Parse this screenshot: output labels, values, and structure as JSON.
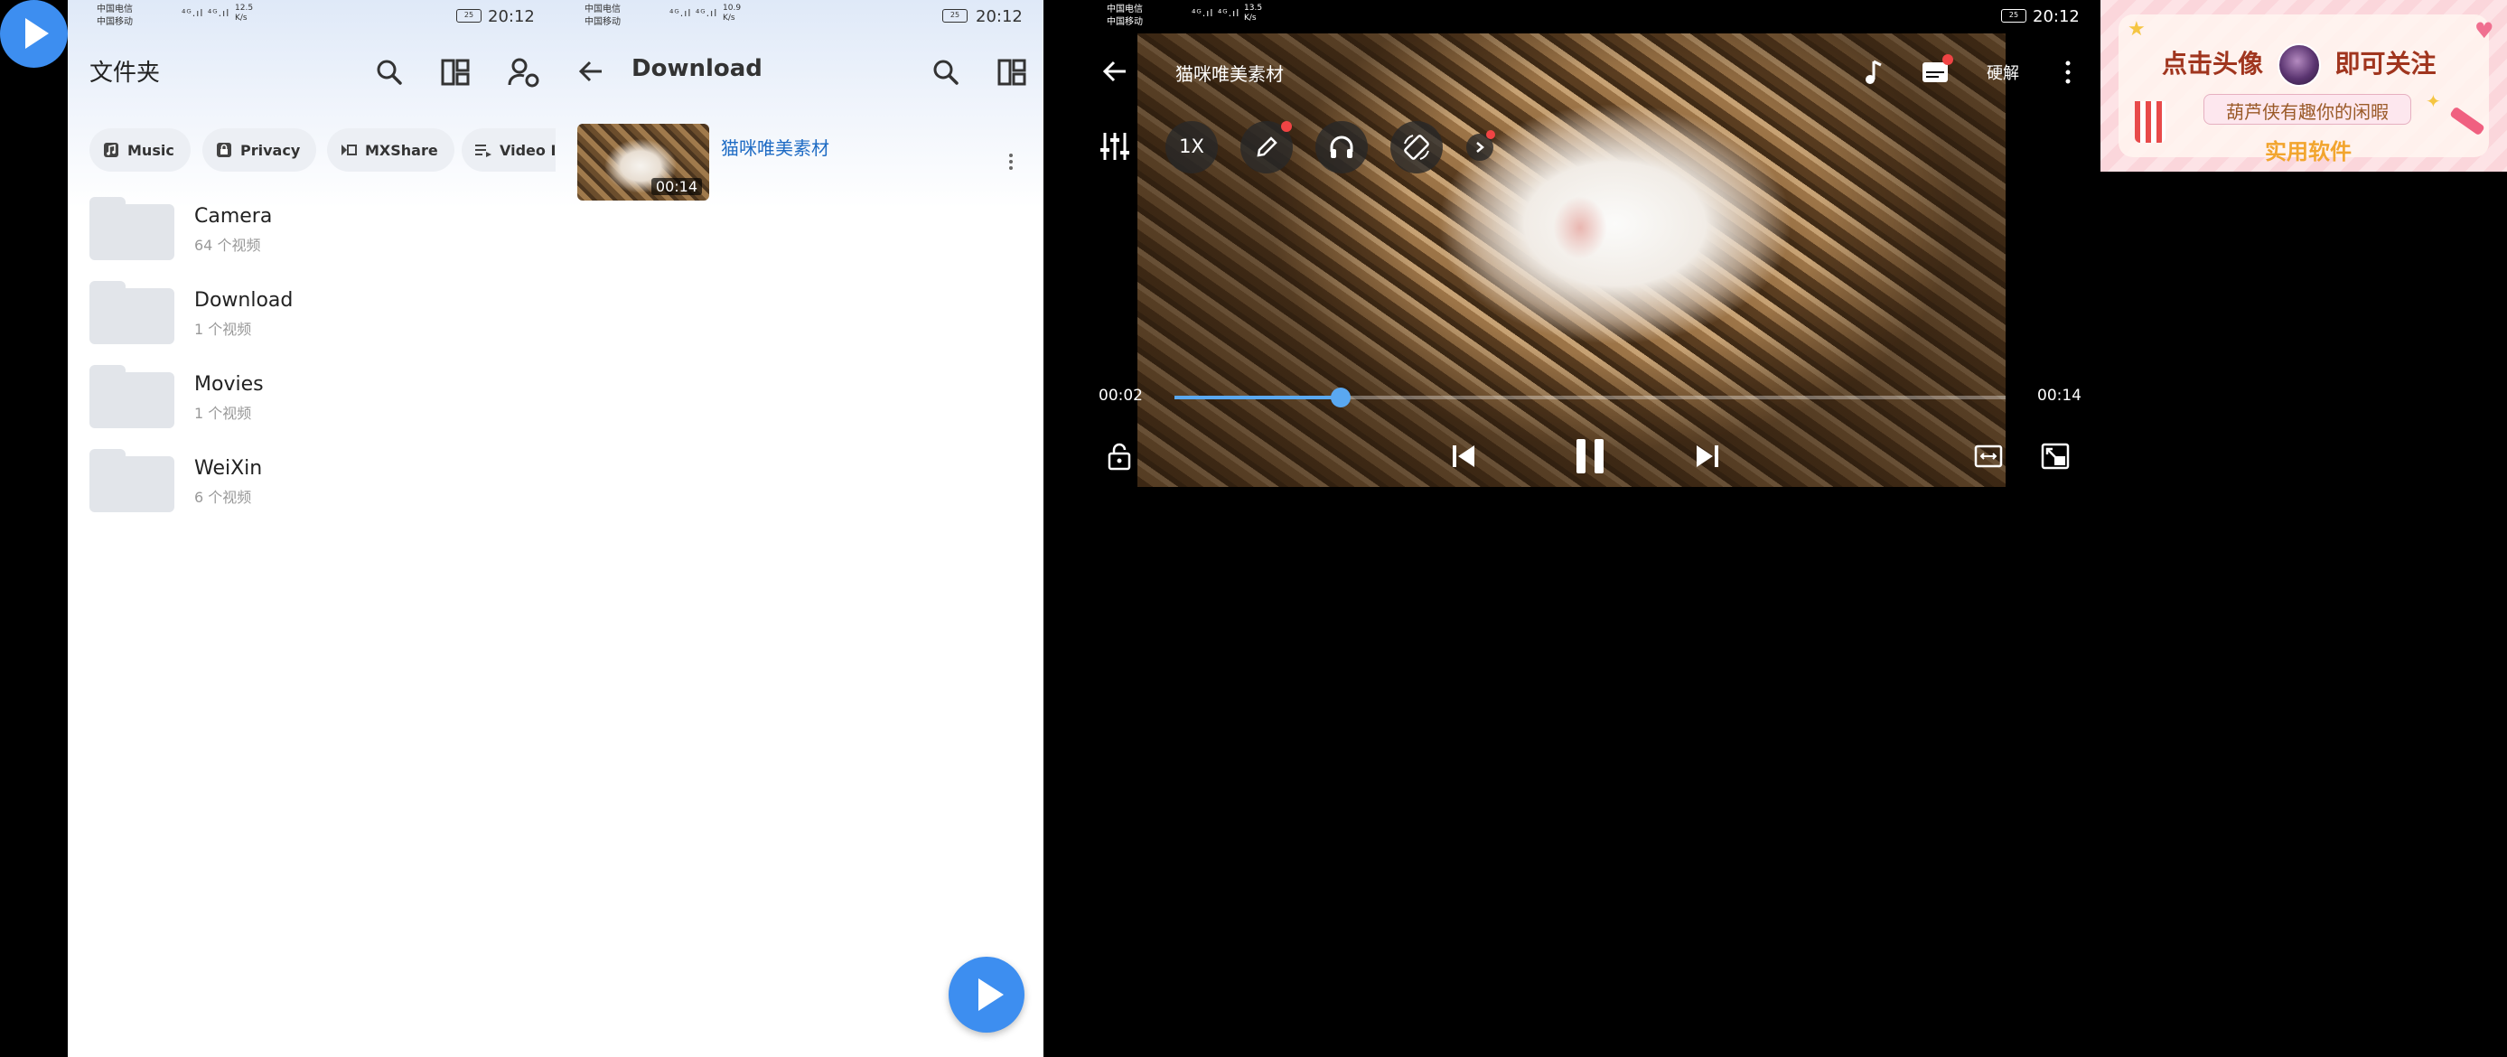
{
  "screen1": {
    "status": {
      "carrier1": "中国电信",
      "carrier2": "中国移动",
      "speed": "12.5",
      "speed_unit": "K/s",
      "battery": "25",
      "time": "20:12"
    },
    "title": "文件夹",
    "chips": [
      {
        "label": "Music"
      },
      {
        "label": "Privacy"
      },
      {
        "label": "MXShare"
      },
      {
        "label": "Video I"
      }
    ],
    "folders": [
      {
        "name": "Camera",
        "count": "64 个视频"
      },
      {
        "name": "Download",
        "count": "1 个视频"
      },
      {
        "name": "Movies",
        "count": "1 个视频"
      },
      {
        "name": "WeiXin",
        "count": "6 个视频"
      }
    ]
  },
  "screen2": {
    "status": {
      "carrier1": "中国电信",
      "carrier2": "中国移动",
      "speed": "10.9",
      "speed_unit": "K/s",
      "battery": "25",
      "time": "20:12"
    },
    "title": "Download",
    "video": {
      "title": "猫咪唯美素材",
      "duration": "00:14"
    }
  },
  "screen3": {
    "status": {
      "carrier1": "中国电信",
      "carrier2": "中国移动",
      "speed": "13.5",
      "speed_unit": "K/s",
      "battery": "25",
      "time": "20:12"
    },
    "title": "猫咪唯美素材",
    "decoder": "硬解",
    "speed_btn": "1X",
    "current_time": "00:02",
    "total_time": "00:14",
    "progress": 0.2
  },
  "banner": {
    "line1a": "点击头像",
    "line1b": "即可关注",
    "line2": "葫芦侠有趣你的闲暇",
    "line3": "实用软件"
  },
  "colors": {
    "accent": "#3d8ef0",
    "progress": "#5aa8f0",
    "link": "#1e6bc4"
  }
}
